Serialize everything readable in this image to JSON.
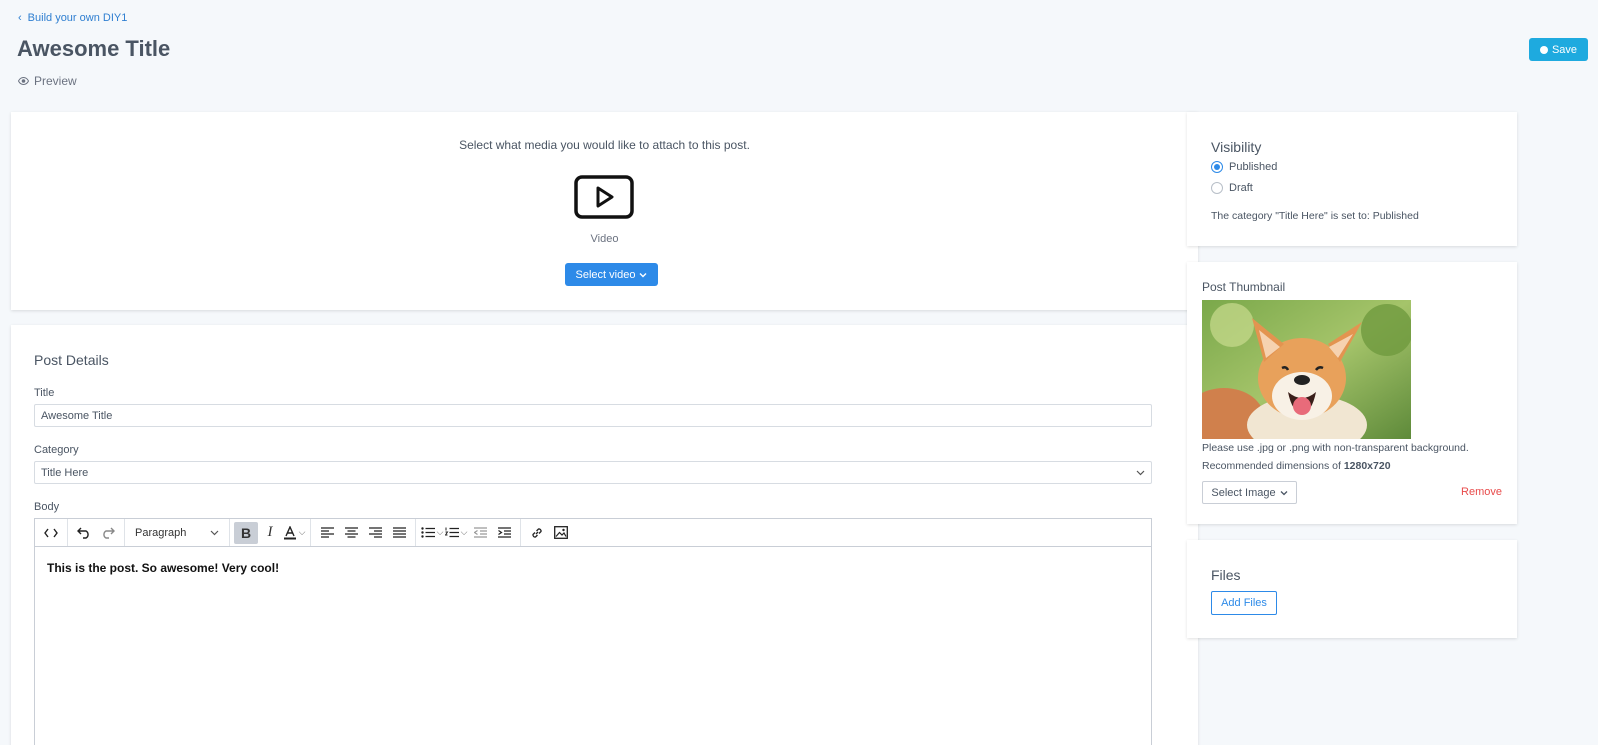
{
  "header": {
    "back_label": "Build your own DIY1",
    "title": "Awesome Title",
    "preview_label": "Preview",
    "save_label": "Save"
  },
  "media": {
    "prompt": "Select what media you would like to attach to this post.",
    "video_label": "Video",
    "select_video_label": "Select video"
  },
  "post_details": {
    "section_title": "Post Details",
    "title_label": "Title",
    "title_value": "Awesome Title",
    "category_label": "Category",
    "category_value": "Title Here",
    "body_label": "Body",
    "paragraph_select": "Paragraph",
    "body_text": "This is the post. So awesome! Very cool!"
  },
  "visibility": {
    "section_title": "Visibility",
    "options": [
      {
        "label": "Published",
        "checked": true
      },
      {
        "label": "Draft",
        "checked": false
      }
    ],
    "note": "The category \"Title Here\" is set to: Published"
  },
  "thumbnail": {
    "section_title": "Post Thumbnail",
    "help_line1": "Please use .jpg or .png with non-transparent background.",
    "help_line2_prefix": "Recommended dimensions of ",
    "help_line2_value": "1280x720",
    "select_image_label": "Select Image",
    "remove_label": "Remove"
  },
  "files": {
    "section_title": "Files",
    "add_files_label": "Add Files"
  },
  "icons": {
    "back": "chevron-left-icon",
    "preview": "eye-icon",
    "save": "circle-icon",
    "video": "play-icon",
    "dropdown": "chevron-down-icon"
  },
  "colors": {
    "accent": "#2d8ae8",
    "save": "#1eaadf",
    "danger": "#e84a4a",
    "background": "#f5f8fb"
  }
}
